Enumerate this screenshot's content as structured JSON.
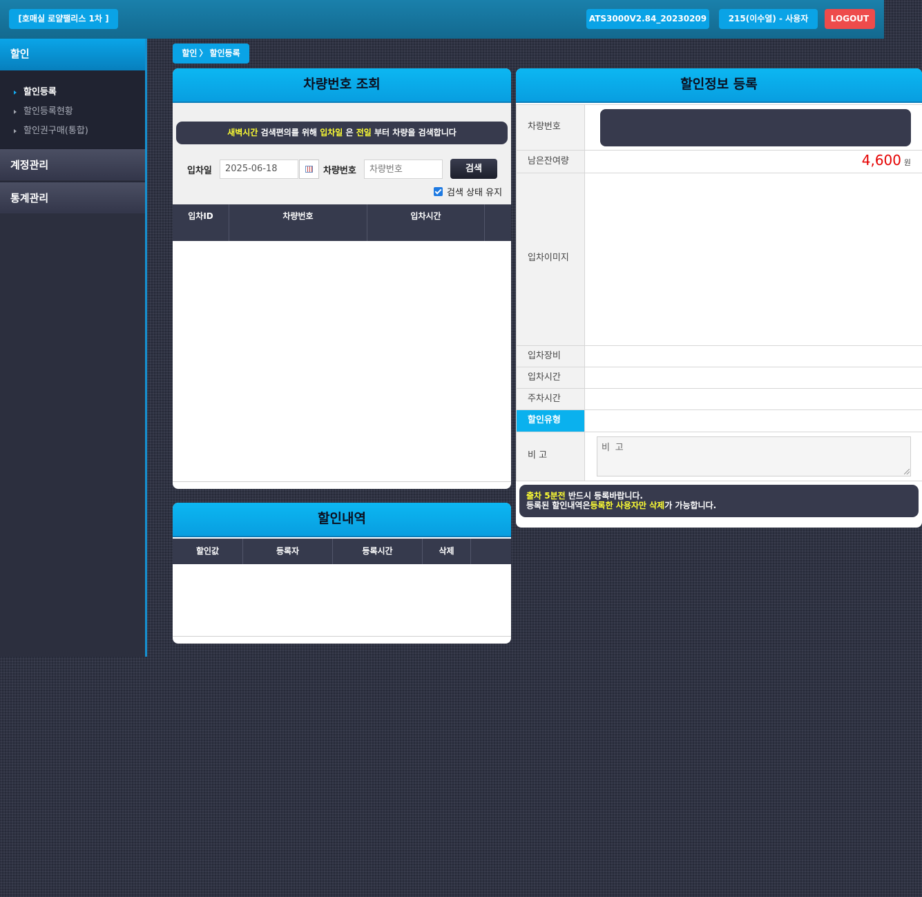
{
  "topbar": {
    "site_label": "[호매실 로얄팰리스 1차 ]",
    "version_label": "ATS3000V2.84_20230209",
    "user_label": "215(이수열) - 사용자",
    "logout_label": "LOGOUT"
  },
  "sidebar": {
    "section_title": "할인",
    "items": [
      {
        "label": "할인등록",
        "active": true
      },
      {
        "label": "할인등록현황",
        "active": false
      },
      {
        "label": "할인권구매(통합)",
        "active": false
      }
    ],
    "menus": [
      "계정관리",
      "통계관리"
    ]
  },
  "breadcrumb": {
    "parent": "할인",
    "separator": "〉",
    "current": "할인등록"
  },
  "vehicle_search": {
    "title": "차량번호 조회",
    "notice": {
      "p1": "새벽시간",
      "p2": " 검색편의를 위해 ",
      "p3": "입차일",
      "p4": " 은 ",
      "p5": "전일",
      "p6": " 부터 차량을 검색합니다"
    },
    "entry_date_label": "입차일",
    "entry_date_value": "2025-06-18",
    "plate_label": "차량번호",
    "plate_placeholder": "차량번호",
    "search_button": "검색",
    "keep_state_label": "검색 상태 유지",
    "keep_state_checked": true,
    "columns": [
      "입차ID",
      "차량번호",
      "입차시간"
    ],
    "rows": []
  },
  "discount_history": {
    "title": "할인내역",
    "columns": [
      "할인값",
      "등록자",
      "등록시간",
      "삭제"
    ],
    "rows": []
  },
  "discount_register": {
    "title": "할인정보 등록",
    "fields": {
      "plate": "차량번호",
      "remaining": "남은잔여량",
      "remaining_value": "4,600",
      "remaining_unit": "원",
      "entry_image": "입차이미지",
      "entry_device": "입차장비",
      "entry_time": "입차시간",
      "parking_time": "주차시간",
      "discount_type": "할인유형",
      "remark": "비 고",
      "remark_placeholder": "비 고"
    },
    "note": {
      "l1a": "출차 5분전",
      "l1b": " 반드시 등록바랍니다.",
      "l2a": "등록된 할인내역은",
      "l2b": "등록한 사용자만 삭제",
      "l2c": "가 가능합니다."
    }
  },
  "colors": {
    "accent": "#0aa3e6",
    "logout": "#ee4b4b",
    "highlight": "#ffff33",
    "remaining": "#e50000"
  }
}
